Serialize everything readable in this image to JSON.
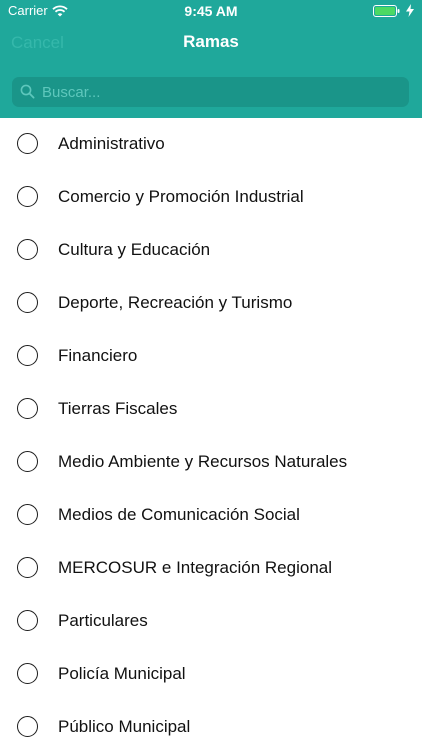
{
  "status_bar": {
    "carrier": "Carrier",
    "time": "9:45 AM"
  },
  "nav": {
    "cancel_label": "Cancel",
    "title": "Ramas"
  },
  "search": {
    "placeholder": "Buscar..."
  },
  "items": [
    {
      "label": "Administrativo"
    },
    {
      "label": "Comercio y Promoción Industrial"
    },
    {
      "label": "Cultura y Educación"
    },
    {
      "label": "Deporte, Recreación y Turismo"
    },
    {
      "label": "Financiero"
    },
    {
      "label": "Tierras Fiscales"
    },
    {
      "label": "Medio Ambiente y Recursos Naturales"
    },
    {
      "label": "Medios de Comunicación Social"
    },
    {
      "label": "MERCOSUR e Integración Regional"
    },
    {
      "label": "Particulares"
    },
    {
      "label": "Policía Municipal"
    },
    {
      "label": "Público Municipal"
    }
  ],
  "colors": {
    "header_bg": "#1fa89b",
    "search_bg": "#1a9589",
    "cancel_text": "#35b8ab"
  },
  "icons": [
    "wifi-icon",
    "battery-icon",
    "charge-icon",
    "search-icon",
    "radio-unchecked-icon"
  ]
}
